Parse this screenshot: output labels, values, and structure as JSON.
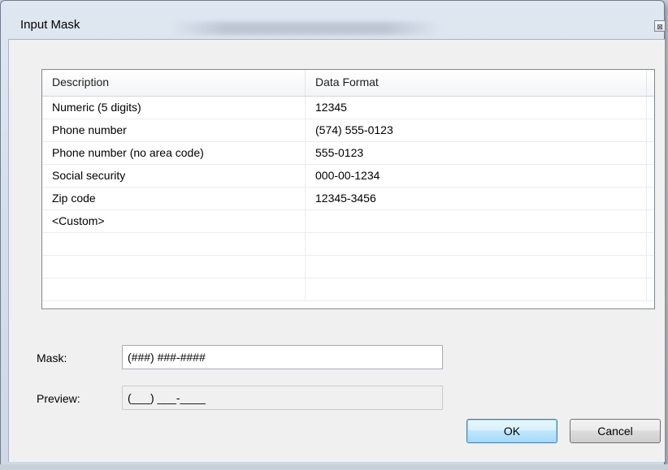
{
  "window": {
    "title": "Input Mask",
    "close_glyph": "⊠"
  },
  "grid": {
    "columns": [
      "Description",
      "Data Format"
    ],
    "rows": [
      {
        "description": "Numeric (5 digits)",
        "format": "12345"
      },
      {
        "description": "Phone number",
        "format": "(574) 555-0123"
      },
      {
        "description": "Phone number (no area code)",
        "format": "555-0123"
      },
      {
        "description": "Social security",
        "format": "000-00-1234"
      },
      {
        "description": "Zip code",
        "format": "12345-3456"
      },
      {
        "description": "<Custom>",
        "format": ""
      },
      {
        "description": "",
        "format": ""
      },
      {
        "description": "",
        "format": ""
      },
      {
        "description": "",
        "format": ""
      }
    ]
  },
  "form": {
    "mask_label": "Mask:",
    "mask_value": "(###) ###-####",
    "preview_label": "Preview:",
    "preview_value": "(___) ___-____"
  },
  "buttons": {
    "ok_label": "OK",
    "cancel_label": "Cancel"
  },
  "colors": {
    "dialog_background": "#f0f0f0",
    "default_button_border": "#3c7fb1"
  },
  "icons": {
    "close": "close-icon"
  }
}
